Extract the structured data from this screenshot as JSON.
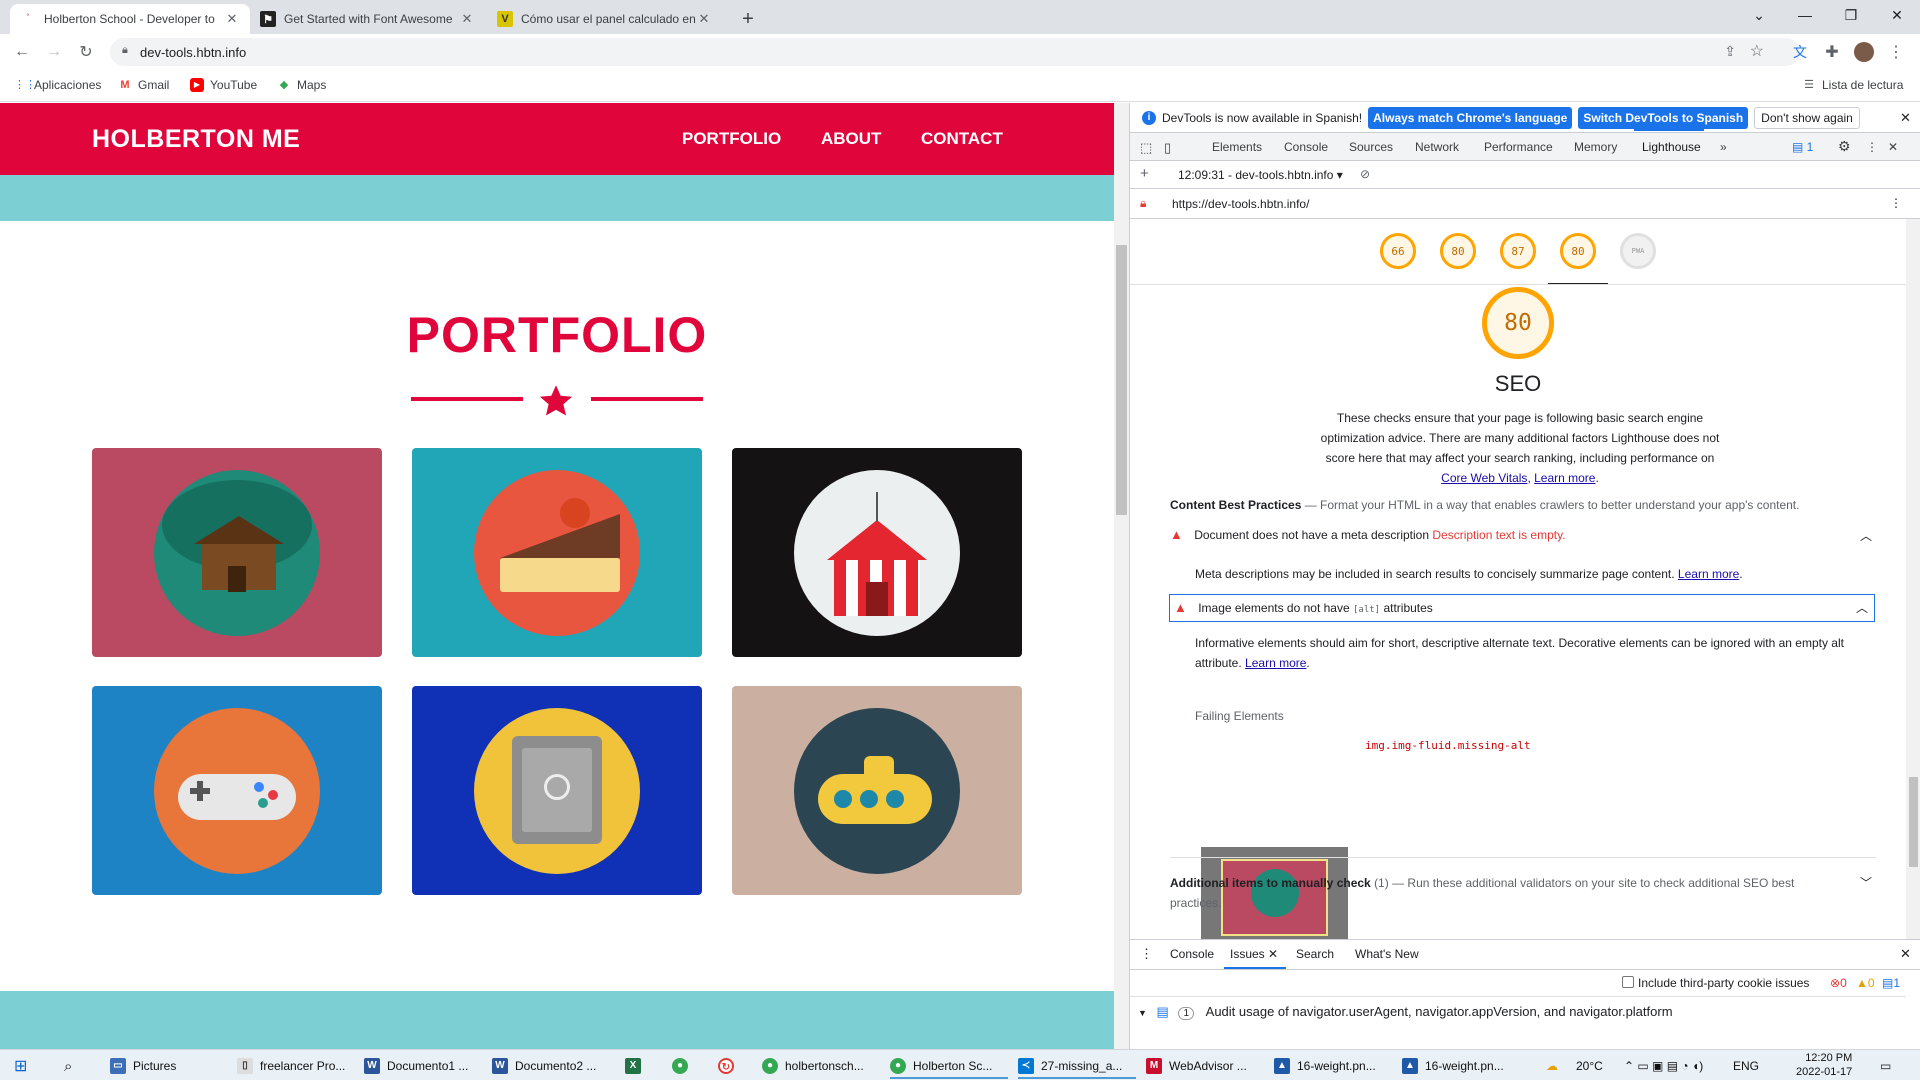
{
  "tabs": [
    {
      "title": "Holberton School - Developer to",
      "active": true
    },
    {
      "title": "Get Started with Font Awesome",
      "active": false
    },
    {
      "title": "Cómo usar el panel calculado en",
      "active": false
    }
  ],
  "new_tab_symbol": "+",
  "window_controls": {
    "minimize": "—",
    "maximize": "❐",
    "close": "✕",
    "tab_search": "⌄"
  },
  "address": {
    "url": "dev-tools.hbtn.info"
  },
  "bookmarks": [
    "Aplicaciones",
    "Gmail",
    "YouTube",
    "Maps"
  ],
  "reading_list": "Lista de lectura",
  "site": {
    "brand": "HOLBERTON ME",
    "nav": [
      "PORTFOLIO",
      "ABOUT",
      "CONTACT"
    ],
    "section_title": "PORTFOLIO",
    "cards": [
      {
        "bg": "#b94a62",
        "circle": "#1f8a78",
        "icon": "log-cabin-icon"
      },
      {
        "bg": "#21a6b8",
        "circle": "#e8563f",
        "icon": "cake-icon"
      },
      {
        "bg": "#151213",
        "circle": "#ecefef",
        "icon": "circus-tent-icon"
      },
      {
        "bg": "#1e83c4",
        "circle": "#e8753a",
        "icon": "game-controller-icon"
      },
      {
        "bg": "#1030b5",
        "circle": "#f1c33a",
        "icon": "safe-icon"
      },
      {
        "bg": "#cbb0a2",
        "circle": "#2b4552",
        "icon": "submarine-icon"
      }
    ]
  },
  "devtools": {
    "info_text": "DevTools is now available in Spanish!",
    "info_btn1": "Always match Chrome's language",
    "info_btn2": "Switch DevTools to Spanish",
    "info_btn3": "Don't show again",
    "tabs": [
      "Elements",
      "Console",
      "Sources",
      "Network",
      "Performance",
      "Memory",
      "Lighthouse"
    ],
    "active_tab": "Lighthouse",
    "more_tabs": "»",
    "issues_badge": "1",
    "report_label": "12:09:31 - dev-tools.hbtn.info ▾",
    "page_url": "https://dev-tools.hbtn.info/",
    "scores": [
      "66",
      "80",
      "87",
      "80"
    ],
    "pwa_label": "PWA",
    "big_score": "80",
    "category": "SEO",
    "desc_lines": [
      "These checks ensure that your page is following basic search engine",
      "optimization advice. There are many additional factors Lighthouse does not",
      "score here that may affect your search ranking, including performance on"
    ],
    "desc_link1": "Core Web Vitals",
    "desc_link2": "Learn more",
    "group_title": "Content Best Practices",
    "group_desc": "— Format your HTML in a way that enables crawlers to better understand your app's content.",
    "audit1_title": "Document does not have a meta description",
    "audit1_extra": "Description text is empty.",
    "audit1_desc": "Meta descriptions may be included in search results to concisely summarize page content.",
    "audit2_title_a": "Image elements do not have",
    "audit2_code": "[alt]",
    "audit2_title_b": "attributes",
    "audit2_desc1": "Informative elements should aim for short, descriptive alternate text. Decorative elements can be ignored with an empty alt",
    "audit2_desc2": "attribute.",
    "learn_more": "Learn more",
    "failing_label": "Failing Elements",
    "failing_selector": "img.img-fluid.missing-alt",
    "manual_title": "Additional items to manually check",
    "manual_count": "(1)",
    "manual_desc": "— Run these additional validators on your site to check additional SEO best",
    "manual_desc2": "practices.",
    "drawer_tabs": [
      "Console",
      "Issues",
      "Search",
      "What's New"
    ],
    "drawer_active": "Issues",
    "third_party_label": "Include third-party cookie issues",
    "counts": [
      "0",
      "0",
      "1"
    ],
    "issue_count": "1",
    "issue_text": "Audit usage of navigator.userAgent, navigator.appVersion, and navigator.platform"
  },
  "taskbar": {
    "items": [
      "Pictures",
      "freelancer Pro...",
      "Documento1 ...",
      "Documento2 ...",
      "holbertonsch...",
      "Holberton Sc...",
      "27-missing_a...",
      "WebAdvisor ...",
      "16-weight.pn...",
      "16-weight.pn..."
    ],
    "temp": "20°C",
    "lang": "ENG",
    "time": "12:20 PM",
    "date": "2022-01-17"
  }
}
